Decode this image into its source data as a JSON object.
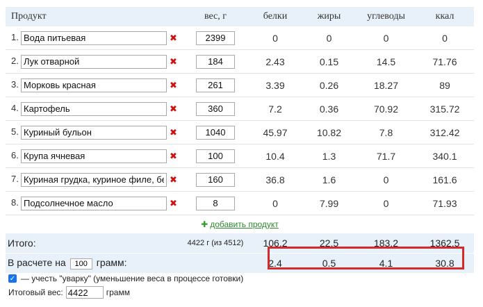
{
  "columns": {
    "product": "Продукт",
    "weight": "вес, г",
    "protein": "белки",
    "fat": "жиры",
    "carbs": "углеводы",
    "kcal": "ккал"
  },
  "rows": [
    {
      "num": "1.",
      "name": "Вода питьевая",
      "weight": "2399",
      "protein": "0",
      "fat": "0",
      "carbs": "0",
      "kcal": "0"
    },
    {
      "num": "2.",
      "name": "Лук отварной",
      "weight": "184",
      "protein": "2.43",
      "fat": "0.15",
      "carbs": "14.5",
      "kcal": "71.76"
    },
    {
      "num": "3.",
      "name": "Морковь красная",
      "weight": "261",
      "protein": "3.39",
      "fat": "0.26",
      "carbs": "18.27",
      "kcal": "89"
    },
    {
      "num": "4.",
      "name": "Картофель",
      "weight": "360",
      "protein": "7.2",
      "fat": "0.36",
      "carbs": "70.92",
      "kcal": "315.72"
    },
    {
      "num": "5.",
      "name": "Куриный бульон",
      "weight": "1040",
      "protein": "45.97",
      "fat": "10.82",
      "carbs": "7.8",
      "kcal": "312.42"
    },
    {
      "num": "6.",
      "name": "Крупа ячневая",
      "weight": "100",
      "protein": "10.4",
      "fat": "1.3",
      "carbs": "71.7",
      "kcal": "340.1"
    },
    {
      "num": "7.",
      "name": "Куриная грудка, куриное филе, без",
      "weight": "160",
      "protein": "36.8",
      "fat": "1.6",
      "carbs": "0",
      "kcal": "161.6"
    },
    {
      "num": "8.",
      "name": "Подсолнечное масло",
      "weight": "8",
      "protein": "0",
      "fat": "7.99",
      "carbs": "0",
      "kcal": "71.93"
    }
  ],
  "delete_symbol": "✖",
  "add_product": {
    "plus": "✚",
    "label": "добавить продукт"
  },
  "totals": {
    "label": "Итого:",
    "weight": "4422 г (из 4512)",
    "protein": "106.2",
    "fat": "22.5",
    "carbs": "183.2",
    "kcal": "1362.5"
  },
  "per_portion": {
    "prefix": "В расчете на",
    "grams_value": "100",
    "suffix": "грамм:",
    "protein": "2.4",
    "fat": "0.5",
    "carbs": "4.1",
    "kcal": "30.8"
  },
  "options": {
    "boil_checkbox_checked": true,
    "checkmark": "✓",
    "boil_label": "— учесть \"уварку\" (уменьшение веса в процессе готовки)",
    "final_weight_label": "Итоговый вес:",
    "final_weight_value": "4422",
    "final_weight_unit": "грамм"
  },
  "colors": {
    "highlight": "#d42a2a",
    "header_bg": "#e8f1f9",
    "delete_icon": "#cc1111",
    "add_link": "#2a8a2a",
    "checkbox": "#1a73e8"
  }
}
